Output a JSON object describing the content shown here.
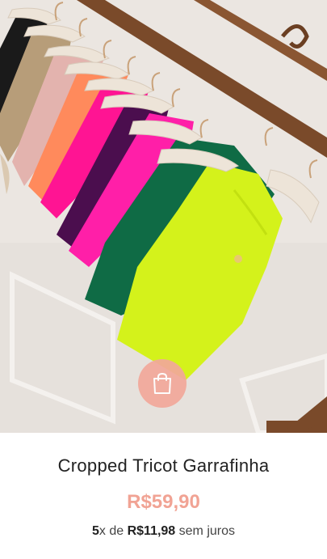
{
  "product": {
    "title": "Cropped Tricot Garrafinha",
    "price": "R$59,90",
    "installments": {
      "count": "5",
      "count_suffix": "x de",
      "amount": "R$11,98",
      "suffix": "sem juros"
    }
  },
  "image": {
    "top_colors": [
      "#1a1a1a",
      "#bfa37f",
      "#e8b9b4",
      "#ff8a5c",
      "#ff1493",
      "#4b0e4e",
      "#ff1fa8",
      "#0f6b45",
      "#d4f21b"
    ]
  },
  "icons": {
    "bag": "shopping-bag-icon"
  },
  "colors": {
    "accent": "#f1a394",
    "button_bg": "#f2a89a"
  }
}
